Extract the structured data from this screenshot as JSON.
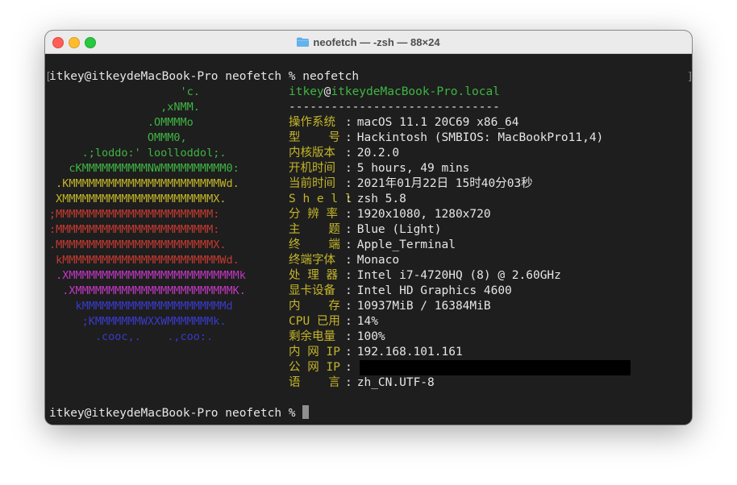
{
  "window": {
    "title": "neofetch — -zsh — 88×24"
  },
  "terminal": {
    "prompt_command": "itkey@itkeydeMacBook-Pro neofetch % neofetch",
    "prompt_final": "itkey@itkeydeMacBook-Pro neofetch % ",
    "bracket_left": "[",
    "bracket_right": "]"
  },
  "logo": [
    {
      "text": "                    'c.",
      "color": "#3fb543"
    },
    {
      "text": "                 ,xNMM.",
      "color": "#3fb543"
    },
    {
      "text": "               .OMMMMo",
      "color": "#3fb543"
    },
    {
      "text": "               OMMM0,",
      "color": "#3fb543"
    },
    {
      "text": "     .;loddo:' loolloddol;.",
      "color": "#3fb543"
    },
    {
      "text": "   cKMMMMMMMMMMNWMMMMMMMMMM0:",
      "color": "#3fb543"
    },
    {
      "text": " .KMMMMMMMMMMMMMMMMMMMMMMMWd.",
      "color": "#c4b52a"
    },
    {
      "text": " XMMMMMMMMMMMMMMMMMMMMMMMX.",
      "color": "#c4b52a"
    },
    {
      "text": ";MMMMMMMMMMMMMMMMMMMMMMMM:",
      "color": "#c43a30"
    },
    {
      "text": ":MMMMMMMMMMMMMMMMMMMMMMMM:",
      "color": "#c43a30"
    },
    {
      "text": ".MMMMMMMMMMMMMMMMMMMMMMMMX.",
      "color": "#c43a30"
    },
    {
      "text": " kMMMMMMMMMMMMMMMMMMMMMMMMWd.",
      "color": "#c43a30"
    },
    {
      "text": " .XMMMMMMMMMMMMMMMMMMMMMMMMMMk",
      "color": "#c238c2"
    },
    {
      "text": "  .XMMMMMMMMMMMMMMMMMMMMMMMMK.",
      "color": "#c238c2"
    },
    {
      "text": "    kMMMMMMMMMMMMMMMMMMMMMMd",
      "color": "#3a3acb"
    },
    {
      "text": "     ;KMMMMMMMWXXWMMMMMMMk.",
      "color": "#3a3acb"
    },
    {
      "text": "       .cooc,.    .,coo:.",
      "color": "#3a3acb"
    }
  ],
  "header": {
    "user": "itkey",
    "at": "@",
    "host": "itkeydeMacBook-Pro.local",
    "separator": "------------------------------"
  },
  "info": [
    {
      "key": "操作系统",
      "value": "macOS 11.1 20C69 x86_64"
    },
    {
      "key": "型    号",
      "value": "Hackintosh (SMBIOS: MacBookPro11,4)"
    },
    {
      "key": "内核版本",
      "value": "20.2.0"
    },
    {
      "key": "开机时间",
      "value": "5 hours, 49 mins"
    },
    {
      "key": "当前时间",
      "value": "2021年01月22日 15时40分03秒"
    },
    {
      "key": "S h e l l",
      "value": "zsh 5.8"
    },
    {
      "key": "分 辨 率",
      "value": "1920x1080, 1280x720"
    },
    {
      "key": "主    题",
      "value": "Blue (Light)"
    },
    {
      "key": "终    端",
      "value": "Apple_Terminal"
    },
    {
      "key": "终端字体",
      "value": "Monaco"
    },
    {
      "key": "处 理 器",
      "value": "Intel i7-4720HQ (8) @ 2.60GHz"
    },
    {
      "key": "显卡设备",
      "value": "Intel HD Graphics 4600"
    },
    {
      "key": "内    存",
      "value": "10937MiB / 16384MiB"
    },
    {
      "key": "CPU 已用",
      "value": "14%"
    },
    {
      "key": "剩余电量",
      "value": "100%"
    },
    {
      "key": "内 网 IP",
      "value": "192.168.101.161"
    },
    {
      "key": "公 网 IP",
      "value": ""
    },
    {
      "key": "语    言",
      "value": "zh_CN.UTF-8"
    }
  ],
  "colors": {
    "key": "#c4b52a",
    "host": "#3fb543",
    "background": "#1e1e1e"
  },
  "icons": {
    "window_title_icon": "folder-icon"
  }
}
